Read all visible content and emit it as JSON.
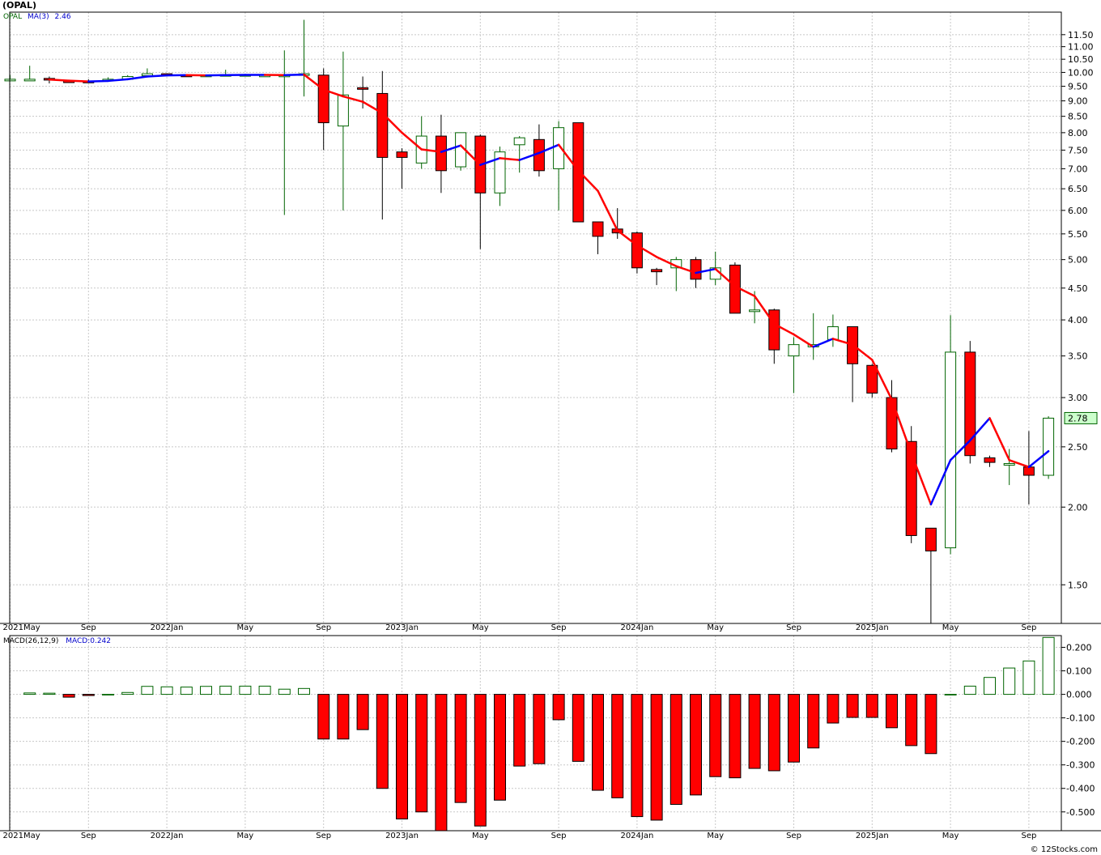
{
  "title": "(OPAL)",
  "credit": "© 12Stocks.com",
  "legend": {
    "symbol": "OPAL",
    "ma_label": "MA(3)",
    "ma_value": "2.46",
    "macd_label": "MACD(26,12,9)",
    "macd_value_label": "MACD:0.242"
  },
  "colors": {
    "up": "#006400",
    "down": "#ff0000",
    "ma_down": "#ff0000",
    "ma_up": "#0000ff",
    "grid": "#c8c8c8",
    "last_price_bg": "#ccffcc"
  },
  "chart_data": [
    {
      "type": "candlestick",
      "symbol": "OPAL",
      "y_scale": "log",
      "ylim": [
        1.3,
        12.5
      ],
      "y_ticks": [
        "1.50",
        "2.00",
        "2.50",
        "3.00",
        "3.50",
        "4.00",
        "4.50",
        "5.00",
        "5.50",
        "6.00",
        "6.50",
        "7.00",
        "7.50",
        "8.00",
        "8.50",
        "9.00",
        "9.50",
        "10.00",
        "10.50",
        "11.00",
        "11.50"
      ],
      "x_labels": [
        "2021May",
        "Sep",
        "2022Jan",
        "May",
        "Sep",
        "2023Jan",
        "May",
        "Sep",
        "2024Jan",
        "May",
        "Sep",
        "2025Jan",
        "May",
        "Sep"
      ],
      "x_label_index": [
        0,
        4,
        8,
        12,
        16,
        20,
        24,
        28,
        32,
        36,
        40,
        44,
        48,
        52
      ],
      "last_price": "2.78",
      "candles": [
        {
          "o": 9.75,
          "h": 9.9,
          "l": 9.7,
          "c": 9.75
        },
        {
          "o": 9.72,
          "h": 10.25,
          "l": 9.7,
          "c": 9.75
        },
        {
          "o": 9.78,
          "h": 9.85,
          "l": 9.6,
          "c": 9.72
        },
        {
          "o": 9.7,
          "h": 9.72,
          "l": 9.62,
          "c": 9.63
        },
        {
          "o": 9.68,
          "h": 9.75,
          "l": 9.62,
          "c": 9.65
        },
        {
          "o": 9.7,
          "h": 9.82,
          "l": 9.7,
          "c": 9.75
        },
        {
          "o": 9.75,
          "h": 9.9,
          "l": 9.75,
          "c": 9.85
        },
        {
          "o": 9.88,
          "h": 10.15,
          "l": 9.85,
          "c": 9.95
        },
        {
          "o": 9.95,
          "h": 9.97,
          "l": 9.85,
          "c": 9.88
        },
        {
          "o": 9.9,
          "h": 9.92,
          "l": 9.85,
          "c": 9.88
        },
        {
          "o": 9.9,
          "h": 9.92,
          "l": 9.88,
          "c": 9.9
        },
        {
          "o": 9.88,
          "h": 10.1,
          "l": 9.88,
          "c": 9.92
        },
        {
          "o": 9.92,
          "h": 9.94,
          "l": 9.9,
          "c": 9.92
        },
        {
          "o": 9.9,
          "h": 9.92,
          "l": 9.88,
          "c": 9.9
        },
        {
          "o": 9.9,
          "h": 10.85,
          "l": 5.9,
          "c": 9.9
        },
        {
          "o": 9.92,
          "h": 12.15,
          "l": 9.15,
          "c": 9.95
        },
        {
          "o": 9.9,
          "h": 10.15,
          "l": 7.5,
          "c": 8.3
        },
        {
          "o": 8.2,
          "h": 10.8,
          "l": 6.0,
          "c": 9.2
        },
        {
          "o": 9.45,
          "h": 9.85,
          "l": 8.75,
          "c": 9.4
        },
        {
          "o": 9.25,
          "h": 10.05,
          "l": 5.8,
          "c": 7.3
        },
        {
          "o": 7.45,
          "h": 7.55,
          "l": 6.5,
          "c": 7.3
        },
        {
          "o": 7.15,
          "h": 8.5,
          "l": 7.0,
          "c": 7.9
        },
        {
          "o": 7.9,
          "h": 8.55,
          "l": 6.4,
          "c": 6.95
        },
        {
          "o": 7.05,
          "h": 8.0,
          "l": 6.95,
          "c": 8.0
        },
        {
          "o": 7.9,
          "h": 7.95,
          "l": 5.2,
          "c": 6.4
        },
        {
          "o": 6.4,
          "h": 7.6,
          "l": 6.1,
          "c": 7.45
        },
        {
          "o": 7.65,
          "h": 7.9,
          "l": 6.9,
          "c": 7.85
        },
        {
          "o": 7.8,
          "h": 8.25,
          "l": 6.8,
          "c": 6.95
        },
        {
          "o": 7.0,
          "h": 8.35,
          "l": 6.0,
          "c": 8.15
        },
        {
          "o": 8.3,
          "h": 8.3,
          "l": 5.75,
          "c": 5.75
        },
        {
          "o": 5.75,
          "h": 5.75,
          "l": 5.1,
          "c": 5.45
        },
        {
          "o": 5.6,
          "h": 6.05,
          "l": 5.4,
          "c": 5.52
        },
        {
          "o": 5.52,
          "h": 5.55,
          "l": 4.75,
          "c": 4.85
        },
        {
          "o": 4.82,
          "h": 4.85,
          "l": 4.55,
          "c": 4.78
        },
        {
          "o": 4.85,
          "h": 5.05,
          "l": 4.45,
          "c": 5.0
        },
        {
          "o": 5.0,
          "h": 5.05,
          "l": 4.5,
          "c": 4.65
        },
        {
          "o": 4.65,
          "h": 5.15,
          "l": 4.55,
          "c": 4.85
        },
        {
          "o": 4.9,
          "h": 4.95,
          "l": 4.1,
          "c": 4.1
        },
        {
          "o": 4.15,
          "h": 4.45,
          "l": 3.95,
          "c": 4.15
        },
        {
          "o": 4.15,
          "h": 4.17,
          "l": 3.4,
          "c": 3.58
        },
        {
          "o": 3.5,
          "h": 3.75,
          "l": 3.05,
          "c": 3.65
        },
        {
          "o": 3.62,
          "h": 4.1,
          "l": 3.45,
          "c": 3.65
        },
        {
          "o": 3.72,
          "h": 4.08,
          "l": 3.62,
          "c": 3.9
        },
        {
          "o": 3.9,
          "h": 3.9,
          "l": 2.95,
          "c": 3.4
        },
        {
          "o": 3.38,
          "h": 3.4,
          "l": 3.0,
          "c": 3.05
        },
        {
          "o": 3.0,
          "h": 3.2,
          "l": 2.45,
          "c": 2.48
        },
        {
          "o": 2.55,
          "h": 2.7,
          "l": 1.75,
          "c": 1.8
        },
        {
          "o": 1.85,
          "h": 1.85,
          "l": 1.3,
          "c": 1.7
        },
        {
          "o": 1.72,
          "h": 4.07,
          "l": 1.68,
          "c": 3.55
        },
        {
          "o": 3.55,
          "h": 3.7,
          "l": 2.35,
          "c": 2.42
        },
        {
          "o": 2.4,
          "h": 2.42,
          "l": 2.32,
          "c": 2.36
        },
        {
          "o": 2.34,
          "h": 2.48,
          "l": 2.17,
          "c": 2.35
        },
        {
          "o": 2.32,
          "h": 2.65,
          "l": 2.02,
          "c": 2.25
        },
        {
          "o": 2.25,
          "h": 2.8,
          "l": 2.22,
          "c": 2.78
        }
      ],
      "ma3": [
        null,
        null,
        9.74,
        9.7,
        9.67,
        9.69,
        9.75,
        9.85,
        9.89,
        9.9,
        9.89,
        9.9,
        9.91,
        9.91,
        9.9,
        9.92,
        9.38,
        9.15,
        8.97,
        8.6,
        8.0,
        7.52,
        7.45,
        7.63,
        7.1,
        7.28,
        7.23,
        7.42,
        7.65,
        6.95,
        6.45,
        5.57,
        5.27,
        5.05,
        4.88,
        4.76,
        4.83,
        4.53,
        4.37,
        3.94,
        3.79,
        3.62,
        3.73,
        3.65,
        3.45,
        2.98,
        2.44,
        2.02,
        2.38,
        2.56,
        2.78,
        2.38,
        2.32,
        2.46
      ]
    },
    {
      "type": "bar",
      "name": "MACD(26,12,9)",
      "ylim": [
        -0.58,
        0.25
      ],
      "y_ticks": [
        "0.200",
        "0.100",
        "0.000",
        "-0.100",
        "-0.200",
        "-0.300",
        "-0.400",
        "-0.500"
      ],
      "values": [
        0.006,
        0.005,
        -0.012,
        -0.005,
        0.0,
        0.008,
        0.034,
        0.032,
        0.031,
        0.034,
        0.035,
        0.035,
        0.035,
        0.022,
        0.025,
        -0.19,
        -0.19,
        -0.15,
        -0.4,
        -0.53,
        -0.5,
        -0.58,
        -0.46,
        -0.56,
        -0.45,
        -0.305,
        -0.295,
        -0.108,
        -0.285,
        -0.408,
        -0.44,
        -0.52,
        -0.535,
        -0.468,
        -0.428,
        -0.35,
        -0.355,
        -0.315,
        -0.325,
        -0.288,
        -0.228,
        -0.122,
        -0.098,
        -0.098,
        -0.142,
        -0.218,
        -0.252,
        0.0,
        0.035,
        0.072,
        0.112,
        0.142,
        0.242
      ]
    }
  ]
}
